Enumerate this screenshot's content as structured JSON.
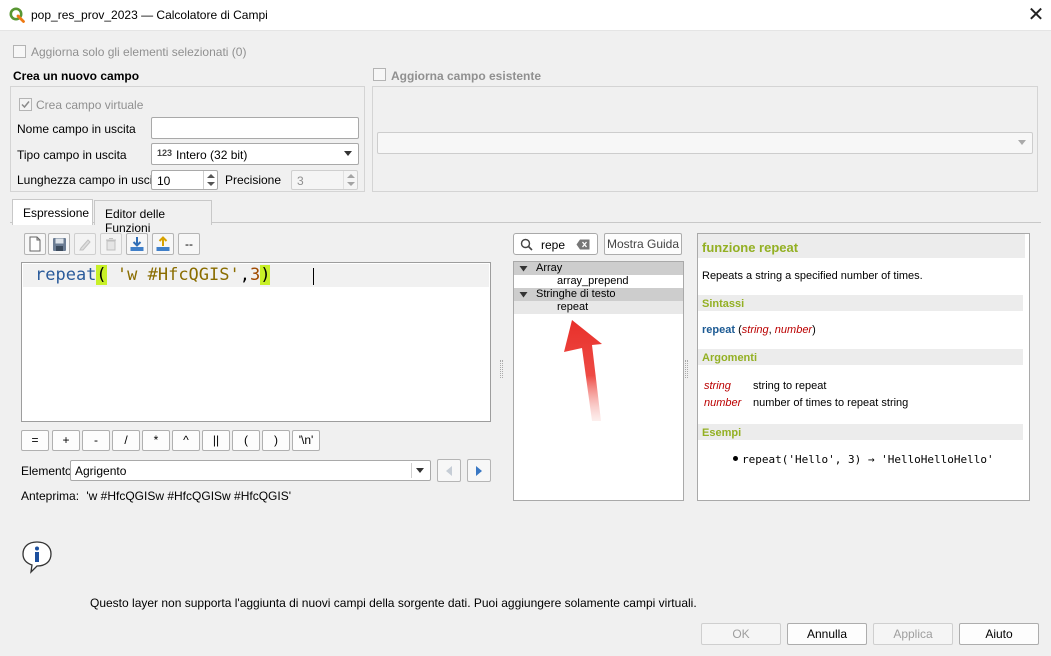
{
  "window": {
    "title": "pop_res_prov_2023 — Calcolatore di Campi",
    "close_glyph": "✕"
  },
  "top": {
    "only_selected_label": "Aggiorna solo gli elementi selezionati (0)"
  },
  "create_field": {
    "heading": "Crea un nuovo campo",
    "virtual_label": "Crea campo virtuale",
    "virtual_checked": true,
    "name_label": "Nome campo in uscita",
    "name_value": "",
    "type_label": "Tipo campo in uscita",
    "type_badge": "123",
    "type_value": "Intero (32 bit)",
    "length_label": "Lunghezza campo in uscita",
    "length_value": "10",
    "precision_label": "Precisione",
    "precision_value": "3"
  },
  "update_field": {
    "heading": "Aggiorna campo esistente",
    "combo_value": ""
  },
  "tabs": [
    {
      "label": "Espressione",
      "active": true
    },
    {
      "label": "Editor delle Funzioni",
      "active": false
    }
  ],
  "editor": {
    "func": "repeat",
    "open_paren": "(",
    "string_arg": " 'w #HfcQGIS'",
    "comma": ",",
    "number_arg": "3",
    "close_paren": ")"
  },
  "operators": [
    "=",
    "+",
    "-",
    "/",
    "*",
    "^",
    "||",
    "(",
    ")",
    "'\\n'"
  ],
  "element": {
    "label": "Elemento",
    "value": "Agrigento"
  },
  "preview": {
    "label": "Anteprima:",
    "value": "'w #HfcQGISw #HfcQGISw #HfcQGIS'"
  },
  "search": {
    "value": "repe",
    "help_button": "Mostra Guida"
  },
  "tree": [
    {
      "label": "Array",
      "type": "group"
    },
    {
      "label": "array_prepend",
      "type": "item"
    },
    {
      "label": "Stringhe di testo",
      "type": "group"
    },
    {
      "label": "repeat",
      "type": "item"
    }
  ],
  "help": {
    "title": "funzione repeat",
    "description": "Repeats a string a specified number of times.",
    "syntax_heading": "Sintassi",
    "syntax_func": "repeat",
    "syntax_open": " (",
    "syntax_arg1": "string",
    "syntax_sep": ", ",
    "syntax_arg2": "number",
    "syntax_close": ")",
    "args_heading": "Argomenti",
    "args": [
      {
        "name": "string",
        "desc": "string to repeat"
      },
      {
        "name": "number",
        "desc": "number of times to repeat string"
      }
    ],
    "examples_heading": "Esempi",
    "example": "repeat('Hello', 3) → 'HelloHelloHello'"
  },
  "info": {
    "icon": "info-icon",
    "message": "Questo layer non supporta l'aggiunta di nuovi campi della sorgente dati. Puoi aggiungere solamente campi virtuali."
  },
  "buttons": {
    "ok": "OK",
    "cancel": "Annulla",
    "apply": "Applica",
    "help": "Aiuto"
  },
  "colors": {
    "help_heading": "#93b023",
    "arrow": "#e8302a",
    "paren_highlight": "#c8f028"
  }
}
